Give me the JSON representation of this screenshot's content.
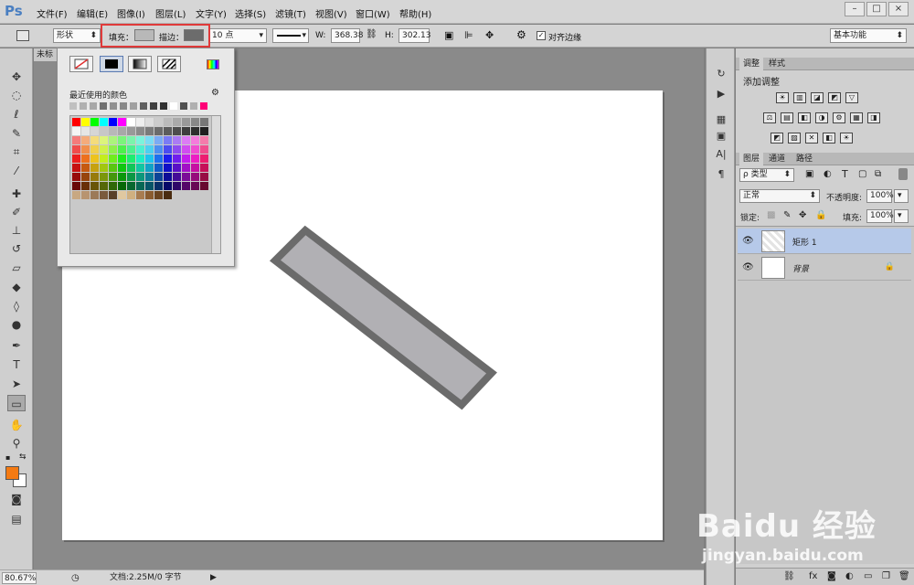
{
  "app": {
    "logo": "Ps"
  },
  "menu": [
    "文件(F)",
    "编辑(E)",
    "图像(I)",
    "图层(L)",
    "文字(Y)",
    "选择(S)",
    "滤镜(T)",
    "视图(V)",
    "窗口(W)",
    "帮助(H)"
  ],
  "window_controls": [
    "–",
    "□",
    "×"
  ],
  "options": {
    "mode": "形状",
    "fill_label": "填充：",
    "stroke_label": "描边：",
    "stroke_width": "10 点",
    "w_label": "W:",
    "w_value": "368.38",
    "h_label": "H:",
    "h_value": "302.13",
    "align_edges": "对齐边缘",
    "workspace": "基本功能",
    "fill_color": "#b8b8b8",
    "stroke_color": "#6c6c6c"
  },
  "doc": {
    "tab": "未标"
  },
  "shape": {
    "fill_color": "#b1b0b4",
    "stroke_color": "#6b6b6b"
  },
  "statusbar": {
    "zoom": "80.67%",
    "doc_info": "文档:2.25M/0 字节"
  },
  "popup": {
    "recent_label": "最近使用的颜色",
    "recent_colors": [
      "#c0c0c0",
      "#b0b0b0",
      "#a8a8a8",
      "#707070",
      "#909090",
      "#888888",
      "#a0a0a0",
      "#606060",
      "#404040",
      "#303030",
      "#ffffff",
      "#505050",
      "#b0b0b0",
      "#ff0077"
    ]
  },
  "panels": {
    "top_tabs": [
      "调整",
      "样式"
    ],
    "add_adjustment": "添加调整",
    "layers_tabs": [
      "图层",
      "通道",
      "路径"
    ],
    "kind_label": "ρ 类型",
    "blend_mode": "正常",
    "opacity_label": "不透明度:",
    "opacity_value": "100%",
    "lock_label": "锁定:",
    "fill_label": "填充:",
    "fill_value": "100%",
    "layers": [
      {
        "name": "矩形 1",
        "selected": true
      },
      {
        "name": "背景",
        "selected": false,
        "locked": true
      }
    ]
  },
  "watermark": {
    "line1": "Baidu 经验",
    "line2": "jingyan.baidu.com"
  }
}
